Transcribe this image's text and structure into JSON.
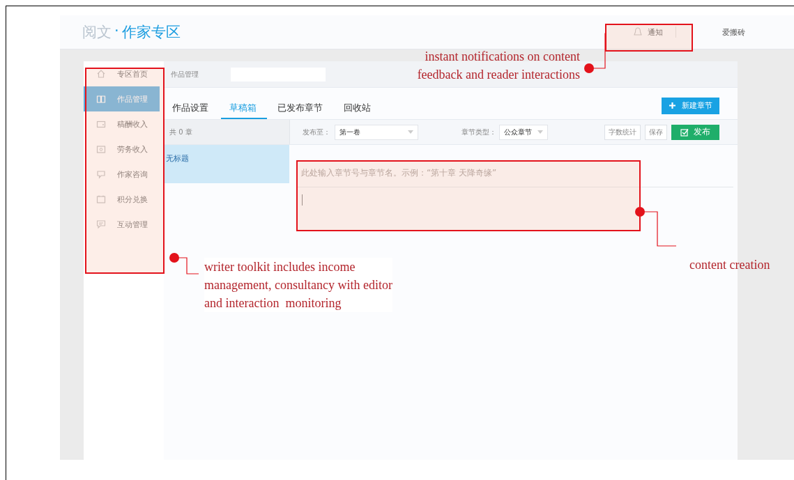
{
  "header": {
    "logo_brand": "阅文",
    "logo_separator": "·",
    "logo_title": "作家专区",
    "notification_label": "通知",
    "username": "爱搬砖"
  },
  "sidebar": {
    "items": [
      {
        "label": "专区首页",
        "selected": false
      },
      {
        "label": "作品管理",
        "selected": true
      },
      {
        "label": "稿酬收入",
        "selected": false
      },
      {
        "label": "劳务收入",
        "selected": false
      },
      {
        "label": "作家咨询",
        "selected": false
      },
      {
        "label": "积分兑换",
        "selected": false
      },
      {
        "label": "互动管理",
        "selected": false
      }
    ]
  },
  "breadcrumb": "作品管理",
  "tabs": [
    {
      "label": "作品设置",
      "selected": false
    },
    {
      "label": "草稿箱",
      "selected": true
    },
    {
      "label": "已发布章节",
      "selected": false
    },
    {
      "label": "回收站",
      "selected": false
    }
  ],
  "new_chapter_button": "新建章节",
  "chapter_count": "共 0 章",
  "toolbar": {
    "publish_to_label": "发布至：",
    "publish_to_value": "第一卷",
    "chapter_type_label": "章节类型：",
    "chapter_type_value": "公众章节",
    "buttons": [
      {
        "label": "字数统计",
        "kind": "plain"
      },
      {
        "label": "保存",
        "kind": "plain"
      },
      {
        "label": "发布",
        "kind": "primary"
      }
    ]
  },
  "chapters": [
    {
      "title": "无标题",
      "selected": true
    }
  ],
  "editor": {
    "title_placeholder": "此处输入章节号与章节名。示例：“第十章 天降奇缘”"
  },
  "annotations": [
    {
      "text": "instant notifications on content\nfeedback and reader interactions"
    },
    {
      "text": "writer toolkit includes income\nmanagement, consultancy with editor\nand interaction  monitoring"
    },
    {
      "text": "content creation"
    }
  ]
}
